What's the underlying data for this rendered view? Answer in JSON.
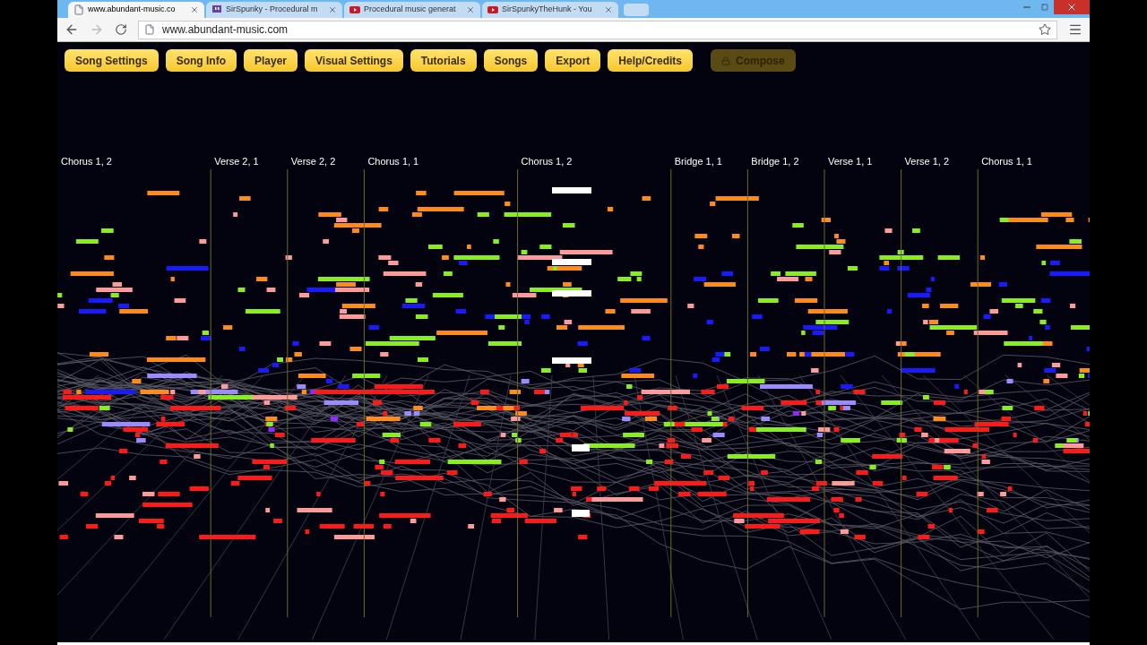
{
  "browser": {
    "tabs": [
      {
        "title": "www.abundant-music.co",
        "selected": true
      },
      {
        "title": "SirSpunky - Procedural m",
        "selected": false
      },
      {
        "title": "Procedural music generat",
        "selected": false
      },
      {
        "title": "SirSpunkyTheHunk - You",
        "selected": false
      }
    ],
    "address": "www.abundant-music.com"
  },
  "toolbar": [
    {
      "label": "Song Settings",
      "disabled": false
    },
    {
      "label": "Song Info",
      "disabled": false
    },
    {
      "label": "Player",
      "disabled": false
    },
    {
      "label": "Visual Settings",
      "disabled": false
    },
    {
      "label": "Tutorials",
      "disabled": false
    },
    {
      "label": "Songs",
      "disabled": false
    },
    {
      "label": "Export",
      "disabled": false
    },
    {
      "label": "Help/Credits",
      "disabled": false
    },
    {
      "label": "Compose",
      "disabled": true
    }
  ],
  "sections": [
    {
      "label": "Chorus 1, 2",
      "kind": "chorus"
    },
    {
      "label": "Verse 2, 1",
      "kind": "verse"
    },
    {
      "label": "Verse 2, 2",
      "kind": "verse"
    },
    {
      "label": "Chorus 1, 1",
      "kind": "chorus"
    },
    {
      "label": "Chorus 1, 2",
      "kind": "chorus"
    },
    {
      "label": "Bridge 1, 1",
      "kind": "bridge"
    },
    {
      "label": "Bridge 1, 2",
      "kind": "bridge"
    },
    {
      "label": "Verse 1, 1",
      "kind": "verse"
    },
    {
      "label": "Verse 1, 2",
      "kind": "verse"
    },
    {
      "label": "Chorus 1, 1",
      "kind": "chorus"
    }
  ]
}
